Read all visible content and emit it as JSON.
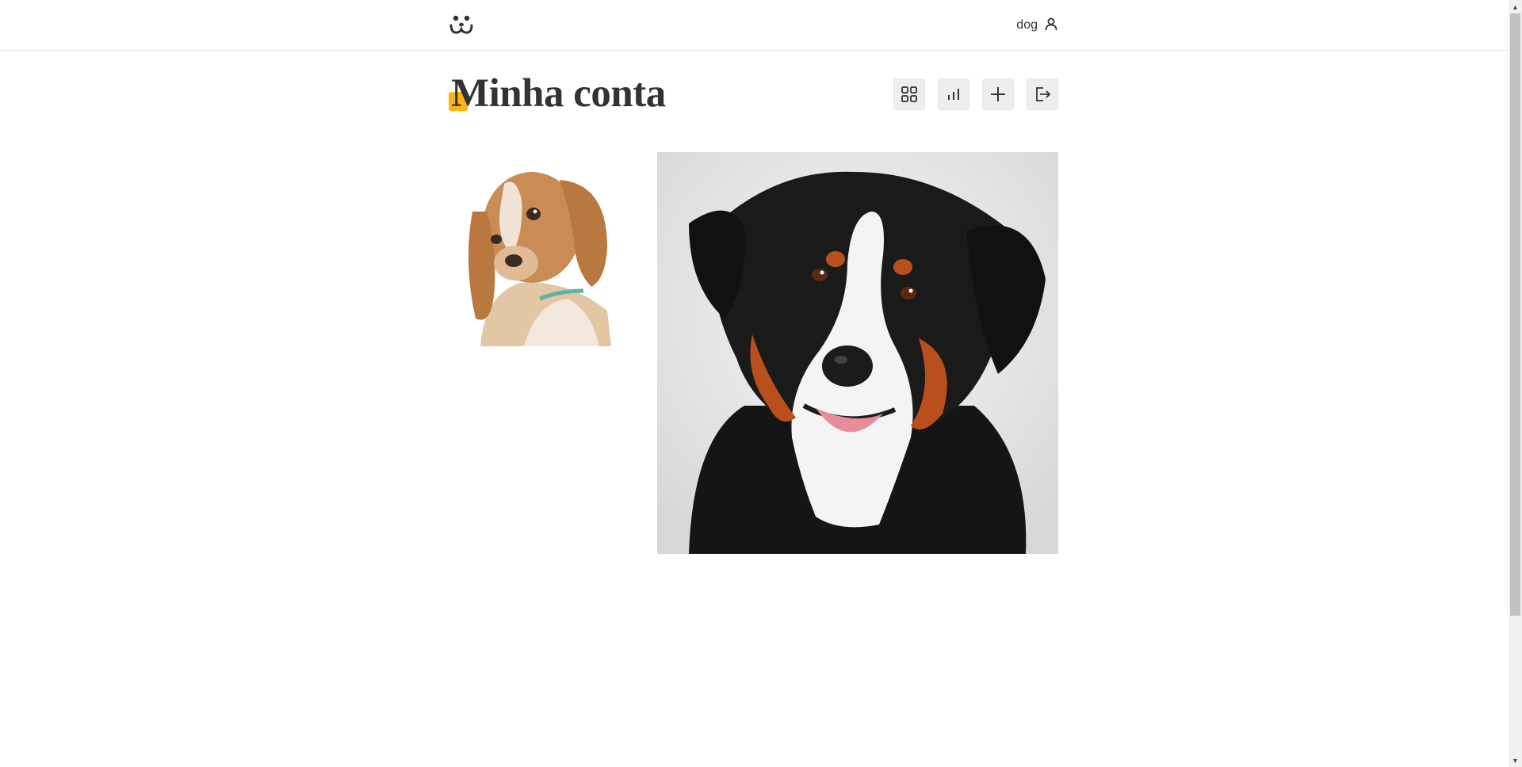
{
  "header": {
    "username": "dog",
    "logo_icon": "dog-face-logo-icon",
    "user_icon": "user-icon"
  },
  "page": {
    "title": "Minha conta"
  },
  "actions": [
    {
      "icon": "grid-icon",
      "name": "my-photos"
    },
    {
      "icon": "bar-chart-icon",
      "name": "statistics"
    },
    {
      "icon": "plus-icon",
      "name": "add-photo"
    },
    {
      "icon": "logout-icon",
      "name": "logout"
    }
  ],
  "feed": {
    "photos": [
      {
        "subject": "beagle puppy"
      },
      {
        "subject": "bernese mountain dog"
      }
    ]
  },
  "colors": {
    "accent": "#fbb614",
    "text": "#333333",
    "button_bg": "#eeeeee"
  }
}
